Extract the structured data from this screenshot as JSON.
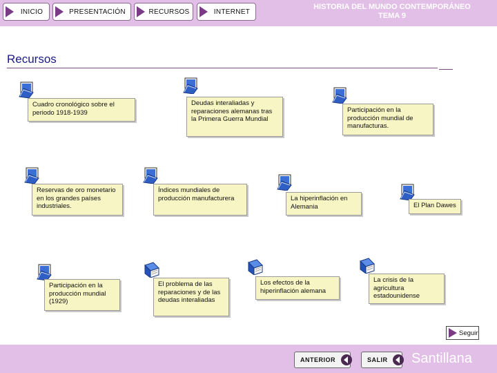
{
  "nav": {
    "inicio": "INICIO",
    "presentacion": "PRESENTACIÓN",
    "recursos": "RECURSOS",
    "internet": "INTERNET"
  },
  "header": {
    "title_line1": "HISTORIA DEL MUNDO CONTEMPORÁNEO",
    "title_line2": "TEMA 9"
  },
  "section_title": "Recursos",
  "resources": [
    "Cuadro cronológico sobre el periodo 1918-1939",
    "Deudas interaliadas y reparaciones alemanas tras la Primera Guerra Mundial",
    "Participación en la producción mundial de manufacturas.",
    "Reservas de oro monetario en los grandes países industriales.",
    "Índices mundiales de producción manufacturera",
    "La hiperinflación en Alemania",
    "El Plan Dawes",
    "Participación en la producción mundial (1929)",
    "El problema de las reparaciones y de las deudas interaliadas",
    "Los efectos de la hiperinflación alemana",
    "La crisis de la agricultura estadounidense"
  ],
  "seguir": "Seguir",
  "footer": {
    "anterior": "ANTERIOR",
    "salir": "SALIR",
    "brand": "Santillana"
  },
  "colors": {
    "bar": "#e2bfe6",
    "card": "#f7f5c4",
    "accent": "#7a3a86"
  }
}
